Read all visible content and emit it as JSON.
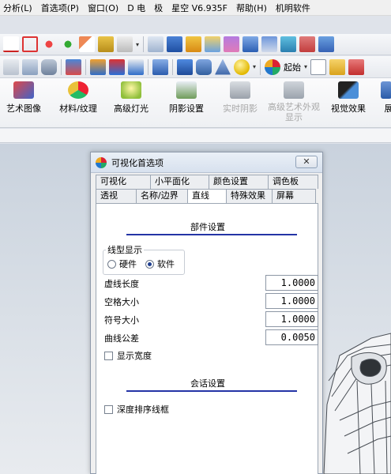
{
  "menu": [
    "分析(L)",
    "首选项(P)",
    "窗口(O)",
    "D 电",
    "极",
    "星空 V6.935F",
    "帮助(H)",
    "机明软件"
  ],
  "toolbar2": {
    "dropdown_label": "起始"
  },
  "ribbon": [
    {
      "label": "艺术图像",
      "enabled": true
    },
    {
      "label": "材料/纹理",
      "enabled": true
    },
    {
      "label": "高级灯光",
      "enabled": true
    },
    {
      "label": "阴影设置",
      "enabled": true
    },
    {
      "label": "实时阴影",
      "enabled": false
    },
    {
      "label": "高级艺术外观\n显示",
      "enabled": false
    },
    {
      "label": "视觉效果",
      "enabled": true
    },
    {
      "label": "展",
      "enabled": true
    }
  ],
  "dialog": {
    "title": "可视化首选项",
    "close_label": "✕",
    "tabs_row1": [
      "可视化",
      "小平面化",
      "颜色设置",
      "调色板"
    ],
    "tabs_row2": [
      "透视",
      "名称/边界",
      "直线",
      "特殊效果",
      "屏幕"
    ],
    "active_tab": "直线",
    "section1": "部件设置",
    "line_display": {
      "label": "线型显示",
      "hard": "硬件",
      "soft": "软件",
      "selected": "软件"
    },
    "fields": [
      {
        "label": "虚线长度",
        "value": "1.0000"
      },
      {
        "label": "空格大小",
        "value": "1.0000"
      },
      {
        "label": "符号大小",
        "value": "1.0000"
      },
      {
        "label": "曲线公差",
        "value": "0.0050"
      }
    ],
    "show_width": {
      "label": "显示宽度",
      "checked": false
    },
    "section2": "会话设置",
    "depth_sort": {
      "label": "深度排序线框",
      "checked": false
    }
  }
}
